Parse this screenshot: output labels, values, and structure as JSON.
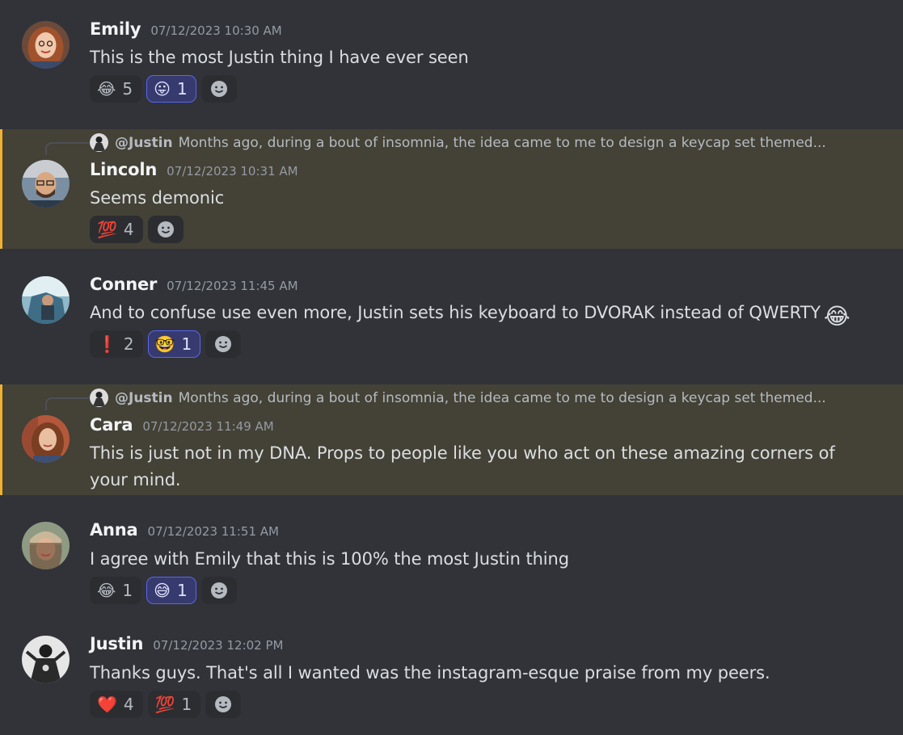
{
  "messages": [
    {
      "author": "Emily",
      "timestamp": "07/12/2023 10:30 AM",
      "text": "This is the most Justin thing I have ever seen",
      "reactions": [
        {
          "emoji": "😂",
          "icon": "tears-of-joy-emoji",
          "count": "5",
          "me": false
        },
        {
          "emoji": "😛",
          "icon": "tongue-out-emoji",
          "count": "1",
          "me": true
        }
      ]
    },
    {
      "author": "Lincoln",
      "timestamp": "07/12/2023 10:31 AM",
      "text": "Seems demonic",
      "reply": {
        "author": "@Justin",
        "text": "Months ago, during a bout of insomnia, the idea came to me to design a keycap set themed..."
      },
      "reactions": [
        {
          "emoji": "💯",
          "icon": "hundred-points-emoji",
          "count": "4",
          "me": false
        }
      ]
    },
    {
      "author": "Conner",
      "timestamp": "07/12/2023 11:45 AM",
      "text": "And to confuse use even more, Justin sets his keyboard to DVORAK instead of QWERTY",
      "inline_emoji": "😂",
      "reactions": [
        {
          "emoji": "❗",
          "icon": "exclamation-emoji",
          "count": "2",
          "me": false
        },
        {
          "emoji": "🤓",
          "icon": "nerd-face-emoji",
          "count": "1",
          "me": true
        }
      ]
    },
    {
      "author": "Cara",
      "timestamp": "07/12/2023 11:49 AM",
      "text_line1": "This is just not in my DNA. Props to people like you who act on these amazing corners of",
      "text_line2": "your mind.",
      "reply": {
        "author": "@Justin",
        "text": "Months ago, during a bout of insomnia, the idea came to me to design a keycap set themed..."
      }
    },
    {
      "author": "Anna",
      "timestamp": "07/12/2023 11:51 AM",
      "text": "I agree with Emily that this is 100% the most Justin thing",
      "reactions": [
        {
          "emoji": "😂",
          "icon": "tears-of-joy-emoji",
          "count": "1",
          "me": false
        },
        {
          "emoji": "😅",
          "icon": "sweat-smile-emoji",
          "count": "1",
          "me": true
        }
      ]
    },
    {
      "author": "Justin",
      "timestamp": "07/12/2023 12:02 PM",
      "text": "Thanks guys. That's all I wanted was the instagram-esque praise from my peers.",
      "reactions": [
        {
          "emoji": "❤️",
          "icon": "red-heart-emoji",
          "count": "4",
          "me": false
        },
        {
          "emoji": "💯",
          "icon": "hundred-points-emoji",
          "count": "1",
          "me": false
        }
      ]
    }
  ],
  "colors": {
    "background": "#313338",
    "mention_highlight": "#444136",
    "mention_bar": "#f0b132",
    "reaction_me_border": "#5865f2"
  }
}
